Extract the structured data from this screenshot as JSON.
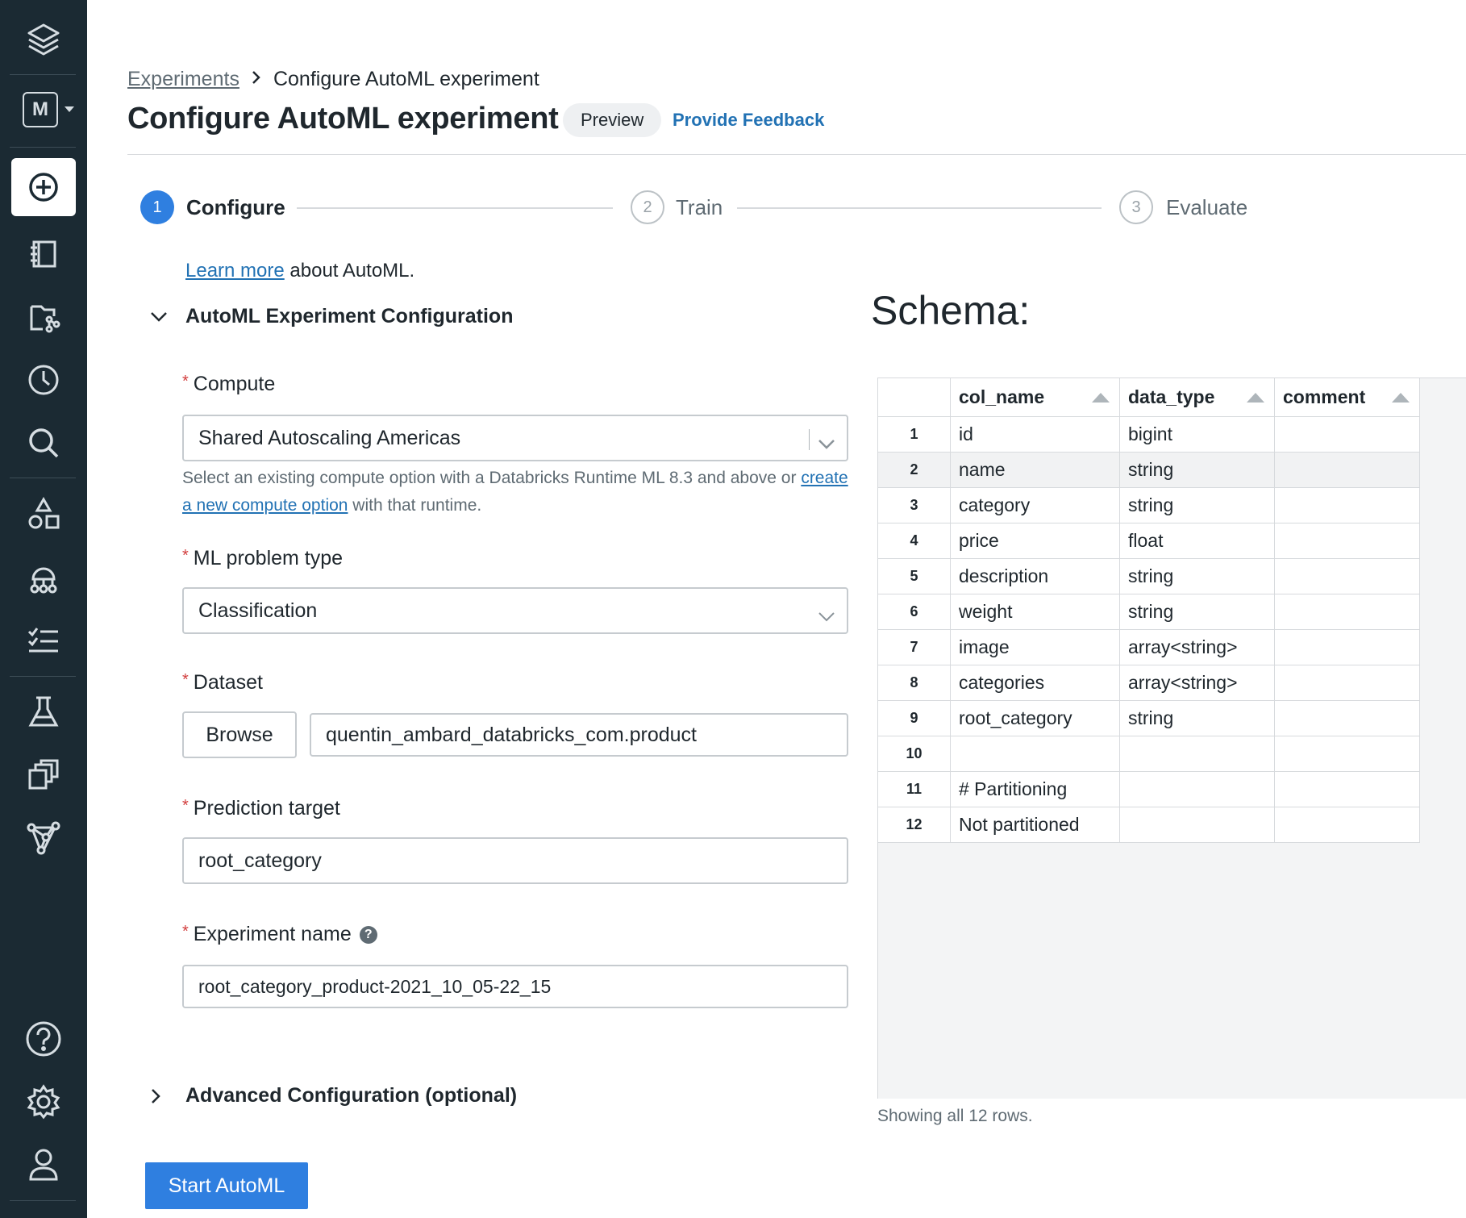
{
  "sidebar": {
    "workspace_letter": "M",
    "items": [
      {
        "icon": "layers-logo-icon"
      },
      {
        "icon": "workspace-switcher-icon"
      },
      {
        "icon": "create-plus-icon"
      },
      {
        "icon": "notebook-icon"
      },
      {
        "icon": "repos-icon"
      },
      {
        "icon": "recents-clock-icon"
      },
      {
        "icon": "search-icon"
      },
      {
        "icon": "data-shapes-icon"
      },
      {
        "icon": "clusters-icon"
      },
      {
        "icon": "jobs-checklist-icon"
      },
      {
        "icon": "experiments-flask-icon"
      },
      {
        "icon": "model-registry-icon"
      },
      {
        "icon": "partner-connect-icon"
      },
      {
        "icon": "help-icon"
      },
      {
        "icon": "settings-gear-icon"
      },
      {
        "icon": "user-account-icon"
      }
    ]
  },
  "breadcrumb": {
    "parent": "Experiments",
    "current": "Configure AutoML experiment"
  },
  "header": {
    "title": "Configure AutoML experiment",
    "badge": "Preview",
    "feedback_link": "Provide Feedback"
  },
  "stepper": {
    "steps": [
      {
        "number": "1",
        "label": "Configure",
        "state": "active"
      },
      {
        "number": "2",
        "label": "Train",
        "state": "inactive"
      },
      {
        "number": "3",
        "label": "Evaluate",
        "state": "inactive"
      }
    ]
  },
  "intro": {
    "link": "Learn more",
    "text": " about AutoML."
  },
  "config_section": {
    "title": "AutoML Experiment Configuration",
    "compute": {
      "label": "Compute",
      "value": "Shared Autoscaling Americas",
      "helper_prefix": "Select an existing compute option with a Databricks Runtime ML 8.3 and above or ",
      "helper_link": "create a new compute option",
      "helper_suffix": " with that runtime."
    },
    "problem_type": {
      "label": "ML problem type",
      "value": "Classification"
    },
    "dataset": {
      "label": "Dataset",
      "browse_label": "Browse",
      "value": "quentin_ambard_databricks_com.product"
    },
    "prediction_target": {
      "label": "Prediction target",
      "value": "root_category"
    },
    "experiment_name": {
      "label": "Experiment name",
      "help_glyph": "?",
      "value": "root_category_product-2021_10_05-22_15"
    }
  },
  "advanced_section": {
    "title": "Advanced Configuration (optional)"
  },
  "start_button": "Start AutoML",
  "schema": {
    "title": "Schema:",
    "columns": [
      "col_name",
      "data_type",
      "comment"
    ],
    "rows": [
      {
        "n": "1",
        "col_name": "id",
        "data_type": "bigint",
        "comment": ""
      },
      {
        "n": "2",
        "col_name": "name",
        "data_type": "string",
        "comment": ""
      },
      {
        "n": "3",
        "col_name": "category",
        "data_type": "string",
        "comment": ""
      },
      {
        "n": "4",
        "col_name": "price",
        "data_type": "float",
        "comment": ""
      },
      {
        "n": "5",
        "col_name": "description",
        "data_type": "string",
        "comment": ""
      },
      {
        "n": "6",
        "col_name": "weight",
        "data_type": "string",
        "comment": ""
      },
      {
        "n": "7",
        "col_name": "image",
        "data_type": "array<string>",
        "comment": ""
      },
      {
        "n": "8",
        "col_name": "categories",
        "data_type": "array<string>",
        "comment": ""
      },
      {
        "n": "9",
        "col_name": "root_category",
        "data_type": "string",
        "comment": ""
      },
      {
        "n": "10",
        "col_name": "",
        "data_type": "",
        "comment": ""
      },
      {
        "n": "11",
        "col_name": "# Partitioning",
        "data_type": "",
        "comment": ""
      },
      {
        "n": "12",
        "col_name": "Not partitioned",
        "data_type": "",
        "comment": ""
      }
    ],
    "footer": "Showing all 12 rows."
  },
  "colors": {
    "sidebar_bg": "#1b2a33",
    "accent_blue": "#2f7fe0",
    "link_blue": "#2272b4",
    "required_red": "#d23d3d"
  }
}
